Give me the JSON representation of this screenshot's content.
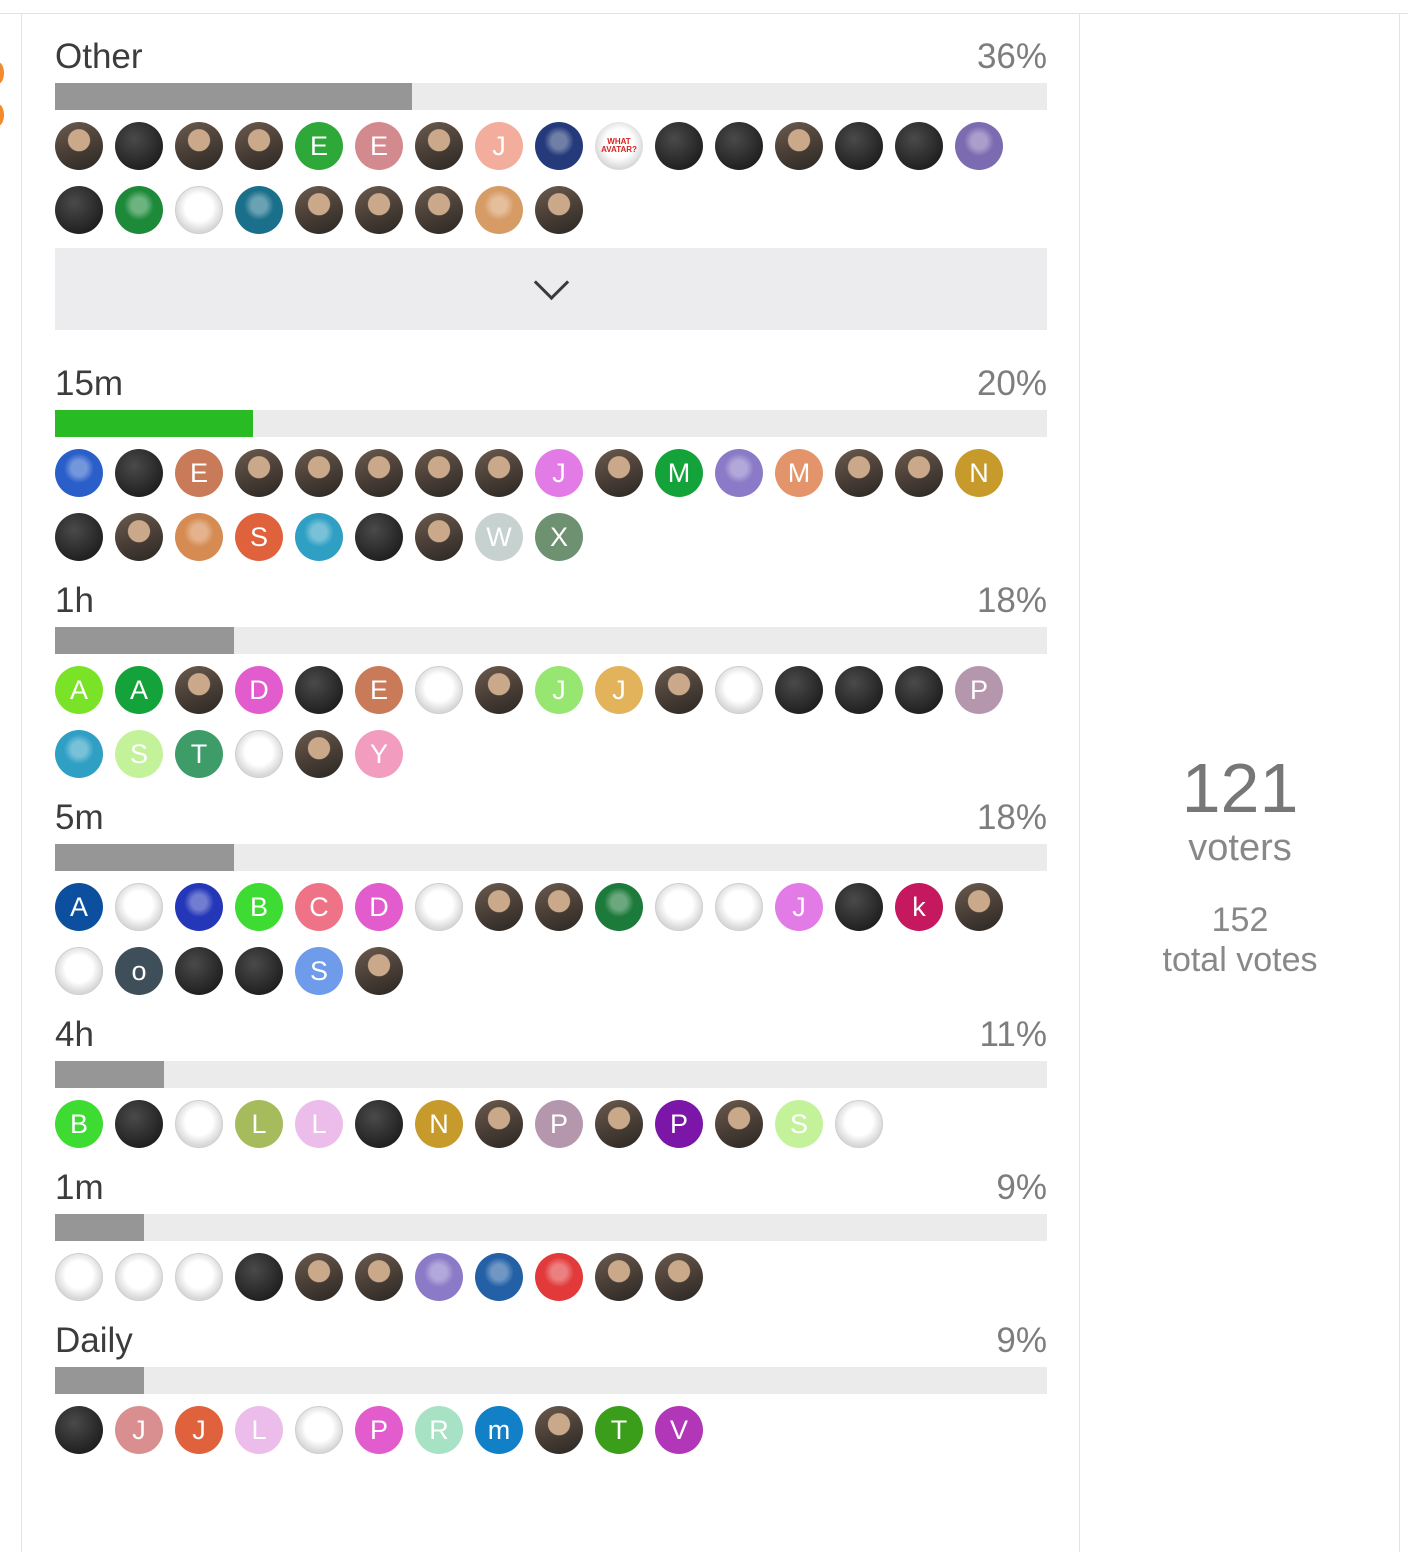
{
  "poll": {
    "options": [
      {
        "label": "Other",
        "pct": "36%",
        "fill": 0.36,
        "winner": false,
        "avatars": [
          {
            "t": "photo"
          },
          {
            "t": "dark"
          },
          {
            "t": "photo"
          },
          {
            "t": "photo"
          },
          {
            "t": "letter",
            "l": "E",
            "c": "#2fa83a"
          },
          {
            "t": "letter",
            "l": "E",
            "c": "#d38a8f"
          },
          {
            "t": "photo"
          },
          {
            "t": "letter",
            "l": "J",
            "c": "#f2ad9c"
          },
          {
            "t": "photo",
            "c": "#243a7a"
          },
          {
            "t": "text",
            "l": "WHAT AVATAR?"
          },
          {
            "t": "dark"
          },
          {
            "t": "dark"
          },
          {
            "t": "photo"
          },
          {
            "t": "dark"
          },
          {
            "t": "dark"
          },
          {
            "t": "photo",
            "c": "#7c6bb0"
          },
          {
            "t": "dark"
          },
          {
            "t": "photo",
            "c": "#1d8a3a"
          },
          {
            "t": "wht"
          },
          {
            "t": "photo",
            "c": "#1a6f8a"
          },
          {
            "t": "photo"
          },
          {
            "t": "photo"
          },
          {
            "t": "photo"
          },
          {
            "t": "photo",
            "c": "#d79b66"
          },
          {
            "t": "photo"
          }
        ]
      },
      {
        "label": "15m",
        "pct": "20%",
        "fill": 0.2,
        "winner": true,
        "avatars": [
          {
            "t": "photo",
            "c": "#2a5fc9"
          },
          {
            "t": "dark"
          },
          {
            "t": "letter",
            "l": "E",
            "c": "#c97a59"
          },
          {
            "t": "photo"
          },
          {
            "t": "photo"
          },
          {
            "t": "photo"
          },
          {
            "t": "photo"
          },
          {
            "t": "photo"
          },
          {
            "t": "letter",
            "l": "J",
            "c": "#e27be6"
          },
          {
            "t": "photo"
          },
          {
            "t": "letter",
            "l": "M",
            "c": "#14a33a"
          },
          {
            "t": "photo",
            "c": "#8a7ac7"
          },
          {
            "t": "letter",
            "l": "M",
            "c": "#e3946a"
          },
          {
            "t": "photo"
          },
          {
            "t": "photo"
          },
          {
            "t": "letter",
            "l": "N",
            "c": "#c69b2b"
          },
          {
            "t": "dark"
          },
          {
            "t": "photo"
          },
          {
            "t": "photo",
            "c": "#d58b52"
          },
          {
            "t": "letter",
            "l": "S",
            "c": "#e0623c"
          },
          {
            "t": "photo",
            "c": "#2fa0c4"
          },
          {
            "t": "dark"
          },
          {
            "t": "photo"
          },
          {
            "t": "letter",
            "l": "W",
            "c": "#c7d1cf"
          },
          {
            "t": "letter",
            "l": "X",
            "c": "#6d9171"
          }
        ]
      },
      {
        "label": "1h",
        "pct": "18%",
        "fill": 0.18,
        "winner": false,
        "avatars": [
          {
            "t": "letter",
            "l": "A",
            "c": "#7be327"
          },
          {
            "t": "letter",
            "l": "A",
            "c": "#14a33a"
          },
          {
            "t": "photo"
          },
          {
            "t": "letter",
            "l": "D",
            "c": "#e25ccd"
          },
          {
            "t": "dark"
          },
          {
            "t": "letter",
            "l": "E",
            "c": "#c97a59"
          },
          {
            "t": "wht"
          },
          {
            "t": "photo"
          },
          {
            "t": "letter",
            "l": "J",
            "c": "#98e672"
          },
          {
            "t": "letter",
            "l": "J",
            "c": "#e3b35c"
          },
          {
            "t": "photo"
          },
          {
            "t": "wht"
          },
          {
            "t": "dark"
          },
          {
            "t": "dark"
          },
          {
            "t": "dark"
          },
          {
            "t": "letter",
            "l": "P",
            "c": "#b497ad"
          },
          {
            "t": "photo",
            "c": "#2fa0c4"
          },
          {
            "t": "letter",
            "l": "S",
            "c": "#c4f29b"
          },
          {
            "t": "letter",
            "l": "T",
            "c": "#3d9c68"
          },
          {
            "t": "wht"
          },
          {
            "t": "photo"
          },
          {
            "t": "letter",
            "l": "Y",
            "c": "#f29cc0"
          }
        ]
      },
      {
        "label": "5m",
        "pct": "18%",
        "fill": 0.18,
        "winner": false,
        "avatars": [
          {
            "t": "letter",
            "l": "A",
            "c": "#0b4f9e"
          },
          {
            "t": "wht"
          },
          {
            "t": "photo",
            "c": "#2437b8"
          },
          {
            "t": "letter",
            "l": "B",
            "c": "#3edb32"
          },
          {
            "t": "letter",
            "l": "C",
            "c": "#ef7386"
          },
          {
            "t": "letter",
            "l": "D",
            "c": "#e25ccd"
          },
          {
            "t": "wht"
          },
          {
            "t": "photo"
          },
          {
            "t": "photo"
          },
          {
            "t": "photo",
            "c": "#1c7a3a"
          },
          {
            "t": "wht"
          },
          {
            "t": "wht"
          },
          {
            "t": "letter",
            "l": "J",
            "c": "#e27be6"
          },
          {
            "t": "dark"
          },
          {
            "t": "letter",
            "l": "k",
            "c": "#c5185f"
          },
          {
            "t": "photo"
          },
          {
            "t": "wht"
          },
          {
            "t": "letter",
            "l": "o",
            "c": "#3f4f5a"
          },
          {
            "t": "dark"
          },
          {
            "t": "dark"
          },
          {
            "t": "letter",
            "l": "S",
            "c": "#6e9bea"
          },
          {
            "t": "photo"
          }
        ]
      },
      {
        "label": "4h",
        "pct": "11%",
        "fill": 0.11,
        "winner": false,
        "avatars": [
          {
            "t": "letter",
            "l": "B",
            "c": "#3edb32"
          },
          {
            "t": "dark"
          },
          {
            "t": "wht"
          },
          {
            "t": "letter",
            "l": "L",
            "c": "#a6bb5c"
          },
          {
            "t": "letter",
            "l": "L",
            "c": "#ecbdea"
          },
          {
            "t": "dark"
          },
          {
            "t": "letter",
            "l": "N",
            "c": "#c69b2b"
          },
          {
            "t": "photo"
          },
          {
            "t": "letter",
            "l": "P",
            "c": "#b497ad"
          },
          {
            "t": "photo"
          },
          {
            "t": "letter",
            "l": "P",
            "c": "#7b16a8"
          },
          {
            "t": "photo"
          },
          {
            "t": "letter",
            "l": "S",
            "c": "#c4f29b"
          },
          {
            "t": "wht"
          }
        ]
      },
      {
        "label": "1m",
        "pct": "9%",
        "fill": 0.09,
        "winner": false,
        "avatars": [
          {
            "t": "wht"
          },
          {
            "t": "wht"
          },
          {
            "t": "wht"
          },
          {
            "t": "dark"
          },
          {
            "t": "photo"
          },
          {
            "t": "photo"
          },
          {
            "t": "photo",
            "c": "#8a7ac7"
          },
          {
            "t": "photo",
            "c": "#2360a5"
          },
          {
            "t": "photo",
            "c": "#e23a3a"
          },
          {
            "t": "photo"
          },
          {
            "t": "photo"
          }
        ]
      },
      {
        "label": "Daily",
        "pct": "9%",
        "fill": 0.09,
        "winner": false,
        "avatars": [
          {
            "t": "dark"
          },
          {
            "t": "letter",
            "l": "J",
            "c": "#d98f8f"
          },
          {
            "t": "letter",
            "l": "J",
            "c": "#e0623c"
          },
          {
            "t": "letter",
            "l": "L",
            "c": "#ecbdea"
          },
          {
            "t": "wht"
          },
          {
            "t": "letter",
            "l": "P",
            "c": "#e25ccd"
          },
          {
            "t": "letter",
            "l": "R",
            "c": "#a8e2c4"
          },
          {
            "t": "letter",
            "l": "m",
            "c": "#1280c7"
          },
          {
            "t": "photo"
          },
          {
            "t": "letter",
            "l": "T",
            "c": "#3a9e1a"
          },
          {
            "t": "letter",
            "l": "V",
            "c": "#b236b8"
          }
        ]
      }
    ]
  },
  "summary": {
    "voters_count": "121",
    "voters_label": "voters",
    "votes_count": "152",
    "votes_label": "total votes"
  }
}
